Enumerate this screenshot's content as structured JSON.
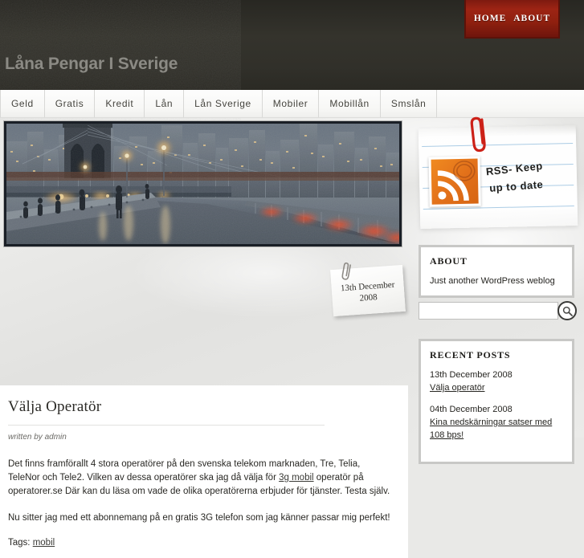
{
  "header": {
    "site_title": "Låna Pengar I Sverige",
    "top_nav": [
      {
        "label": "HOME"
      },
      {
        "label": "ABOUT"
      }
    ]
  },
  "tabs": [
    {
      "label": "Geld"
    },
    {
      "label": "Gratis"
    },
    {
      "label": "Kredit"
    },
    {
      "label": "Lån"
    },
    {
      "label": "Lån Sverige"
    },
    {
      "label": "Mobiler"
    },
    {
      "label": "Mobillån"
    },
    {
      "label": "Smslån"
    }
  ],
  "hero": {
    "alt": "Brooklyn Bridge walkway at dusk with Manhattan skyline"
  },
  "article": {
    "title": "Välja Operatör",
    "byline": "written by admin",
    "date_line1": "13th December",
    "date_line2": "2008",
    "paragraph1_before": "Det finns framförallt 4 stora operatörer på den svenska telekom marknaden, Tre, Telia, TeleNor och Tele2. Vilken av dessa operatörer ska jag då välja för ",
    "paragraph1_link": "3g mobil",
    "paragraph1_after": " operatör på operatorer.se Där kan du läsa om vade de olika operatörerna erbjuder för tjänster. Testa själv.",
    "paragraph2": "Nu sitter jag med ett abonnemang på en gratis 3G telefon som jag känner passar mig perfekt!",
    "tags_label": "Tags:",
    "tags": [
      "mobil"
    ]
  },
  "sidebar": {
    "rss": {
      "line1": "RSS- Keep",
      "line2": "up to date",
      "icon": "rss-stamp-icon"
    },
    "about": {
      "title": "ABOUT",
      "text": "Just another WordPress weblog"
    },
    "search": {
      "value": "",
      "placeholder": "",
      "icon": "search-icon"
    },
    "recent_posts": {
      "title": "RECENT POSTS",
      "items": [
        {
          "date": "13th December 2008",
          "title": "Välja operatör"
        },
        {
          "date": "04th December 2008",
          "title": "Kina nedskärningar satser med 108 bps!"
        }
      ]
    }
  },
  "colors": {
    "accent_red": "#9d2414",
    "header_dark": "#32312b",
    "rss_orange": "#e2701a",
    "rule_blue": "#9cc3e0"
  }
}
